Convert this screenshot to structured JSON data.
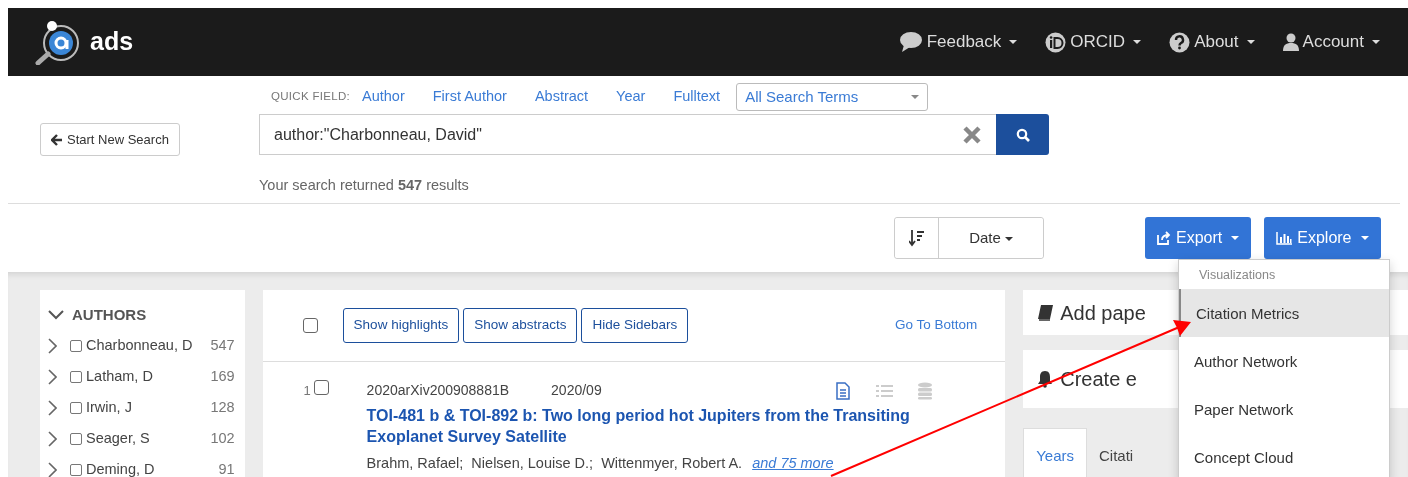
{
  "navbar": {
    "brand": "ads",
    "menus": [
      {
        "kind": "feedback",
        "label": "Feedback"
      },
      {
        "kind": "orcid",
        "label": "ORCID"
      },
      {
        "kind": "about",
        "label": "About"
      },
      {
        "kind": "account",
        "label": "Account"
      }
    ]
  },
  "quick_field": {
    "label": "QUICK FIELD:",
    "links": [
      "Author",
      "First Author",
      "Abstract",
      "Year",
      "Fulltext"
    ],
    "select": "All Search Terms"
  },
  "start_button": "Start New Search",
  "search": {
    "value": "author:\"Charbonneau, David\""
  },
  "result_summary": "Your search returned **547** results",
  "sort": {
    "field": "Date"
  },
  "export_button": "Export",
  "explore_button": "Explore",
  "explore_menu": {
    "header": "Visualizations",
    "items": [
      {
        "label": "Citation Metrics",
        "selected": true
      },
      {
        "label": "Author Network",
        "selected": false
      },
      {
        "label": "Paper Network",
        "selected": false
      },
      {
        "label": "Concept Cloud",
        "selected": false
      }
    ]
  },
  "facets": {
    "title": "AUTHORS",
    "expanded": true,
    "items": [
      {
        "name": "Charbonneau, D",
        "count": "547",
        "checked": false
      },
      {
        "name": "Latham, D",
        "count": "169",
        "checked": false
      },
      {
        "name": "Irwin, J",
        "count": "128",
        "checked": false
      },
      {
        "name": "Seager, S",
        "count": "102",
        "checked": false
      },
      {
        "name": "Deming, D",
        "count": "91",
        "checked": false
      }
    ]
  },
  "results": {
    "select_all_checked": false,
    "buttons": [
      "Show highlights",
      "Show abstracts",
      "Hide Sidebars"
    ],
    "go_to_bottom": "Go To Bottom",
    "items": [
      {
        "index": "1",
        "checked": false,
        "bibcode": "2020arXiv200908881B",
        "date": "2020/09",
        "resources": [
          {
            "kind": "document",
            "available": true
          },
          {
            "kind": "list",
            "available": false
          },
          {
            "kind": "database",
            "available": false
          }
        ],
        "title": "TOI-481 b & TOI-892 b: Two long period hot Jupiters from the Transiting Exoplanet Survey Satellite",
        "authors": "Brahm, Rafael;  Nielsen, Louise D.;  Wittenmyer, Robert A.",
        "more": "and 75 more"
      }
    ]
  },
  "right_panel": {
    "cards": [
      {
        "kind": "library",
        "label": "Add pape"
      },
      {
        "kind": "notification",
        "label": "Create e"
      }
    ],
    "tabs": [
      {
        "label": "Years",
        "selected": true
      },
      {
        "label": "Citati",
        "selected": false
      }
    ]
  }
}
